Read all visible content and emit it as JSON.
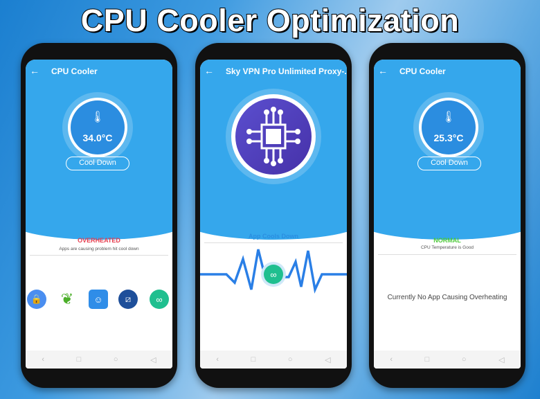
{
  "banner_title": "CPU Cooler Optimization",
  "phones": [
    {
      "title": "CPU Cooler",
      "temperature": "34.0°C",
      "button": "Cool Down",
      "status": "OVERHEATED",
      "status_color": "#e53e4f",
      "subtitle": "Apps are causing problem hit cool down",
      "apps": [
        {
          "icon": "app-lock-icon",
          "color": "#4a8ef0"
        },
        {
          "icon": "maple-leaf-icon",
          "color": "#4caf2a"
        },
        {
          "icon": "keyboard-smile-icon",
          "color": "#2f8de8"
        },
        {
          "icon": "dna-icon",
          "color": "#1e4f9a"
        },
        {
          "icon": "vpn-link-icon",
          "color": "#1fbf8f"
        }
      ]
    },
    {
      "title": "Sky VPN Pro Unlimited Proxy-...",
      "status": "App Cools Down",
      "status_color": "#2a8ee0"
    },
    {
      "title": "CPU Cooler",
      "temperature": "25.3°C",
      "button": "Cool Down",
      "status": "NORMAL",
      "status_color": "#4cc93a",
      "subtitle": "CPU Temperature is Good",
      "message": "Currently No App Causing Overheating"
    }
  ],
  "nav": {
    "back": "‹",
    "recent": "□",
    "home": "○",
    "back_tri": "◁"
  }
}
